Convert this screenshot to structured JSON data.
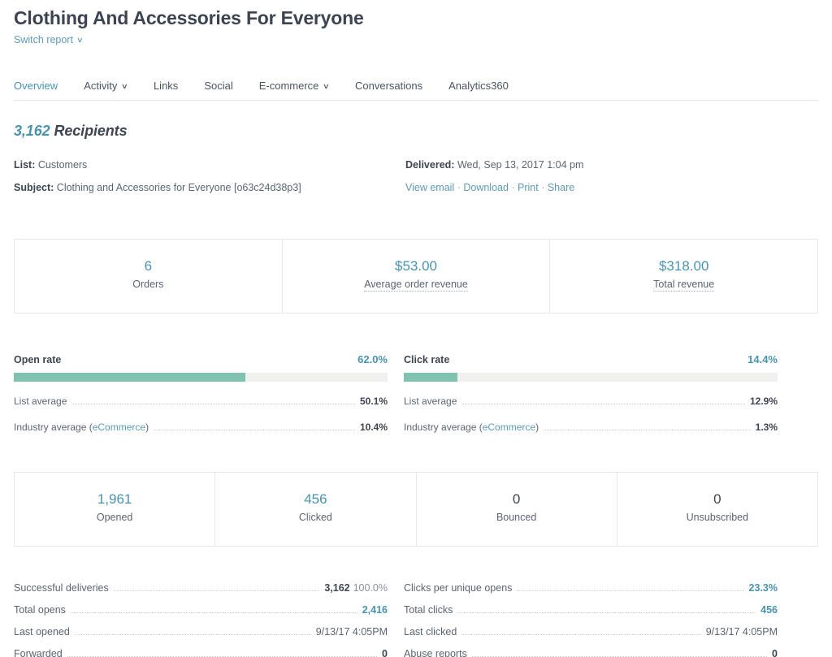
{
  "header": {
    "title": "Clothing And Accessories For Everyone",
    "switch_report": "Switch report",
    "chevron": "∨"
  },
  "tabs": [
    {
      "label": "Overview",
      "has_caret": false,
      "active": true
    },
    {
      "label": "Activity",
      "has_caret": true,
      "active": false
    },
    {
      "label": "Links",
      "has_caret": false,
      "active": false
    },
    {
      "label": "Social",
      "has_caret": false,
      "active": false
    },
    {
      "label": "E-commerce",
      "has_caret": true,
      "active": false
    },
    {
      "label": "Conversations",
      "has_caret": false,
      "active": false
    },
    {
      "label": "Analytics360",
      "has_caret": false,
      "active": false
    }
  ],
  "recipients": {
    "count": "3,162",
    "word": "Recipients"
  },
  "meta": {
    "list_label": "List:",
    "list_value": "Customers",
    "subject_label": "Subject:",
    "subject_value": "Clothing and Accessories for Everyone [o63c24d38p3]",
    "delivered_label": "Delivered:",
    "delivered_value": "Wed, Sep 13, 2017 1:04 pm",
    "actions": [
      "View email",
      "Download",
      "Print",
      "Share"
    ],
    "action_separator": "·"
  },
  "revenue_cards": [
    {
      "value": "6",
      "label": "Orders",
      "tooltip": false,
      "accent": true
    },
    {
      "value": "$53.00",
      "label": "Average order revenue",
      "tooltip": true,
      "accent": true
    },
    {
      "value": "$318.00",
      "label": "Total revenue",
      "tooltip": true,
      "accent": true
    }
  ],
  "rates": [
    {
      "title": "Open rate",
      "percent": "62.0%",
      "fill_pct": 62.0,
      "averages": [
        {
          "label": "List average",
          "link": null,
          "value": "50.1%"
        },
        {
          "label": "Industry average (",
          "link": "eCommerce",
          "label_end": ")",
          "value": "10.4%"
        }
      ]
    },
    {
      "title": "Click rate",
      "percent": "14.4%",
      "fill_pct": 14.4,
      "averages": [
        {
          "label": "List average",
          "link": null,
          "value": "12.9%"
        },
        {
          "label": "Industry average (",
          "link": "eCommerce",
          "label_end": ")",
          "value": "1.3%"
        }
      ]
    }
  ],
  "engagement_cards": [
    {
      "value": "1,961",
      "label": "Opened",
      "accent": true
    },
    {
      "value": "456",
      "label": "Clicked",
      "accent": true
    },
    {
      "value": "0",
      "label": "Bounced",
      "accent": false
    },
    {
      "value": "0",
      "label": "Unsubscribed",
      "accent": false
    }
  ],
  "stats_left": [
    {
      "name": "Successful deliveries",
      "value": "3,162",
      "sub": "100.0%",
      "style": "bold"
    },
    {
      "name": "Total opens",
      "value": "2,416",
      "sub": null,
      "style": "link"
    },
    {
      "name": "Last opened",
      "value": "9/13/17 4:05PM",
      "sub": null,
      "style": "plain"
    },
    {
      "name": "Forwarded",
      "value": "0",
      "sub": null,
      "style": "bold"
    }
  ],
  "stats_right": [
    {
      "name": "Clicks per unique opens",
      "value": "23.3%",
      "sub": null,
      "style": "link"
    },
    {
      "name": "Total clicks",
      "value": "456",
      "sub": null,
      "style": "link"
    },
    {
      "name": "Last clicked",
      "value": "9/13/17 4:05PM",
      "sub": null,
      "style": "plain"
    },
    {
      "name": "Abuse reports",
      "value": "0",
      "sub": null,
      "style": "bold"
    }
  ],
  "colors": {
    "accent_teal": "#4a93b0",
    "link_blue": "#5e9ab5",
    "bar_fill": "#7fc2b0",
    "bar_track": "#f0f0ef",
    "text_dark": "#3d4550",
    "text_muted": "#5b6570",
    "border": "#e6e8ea"
  }
}
